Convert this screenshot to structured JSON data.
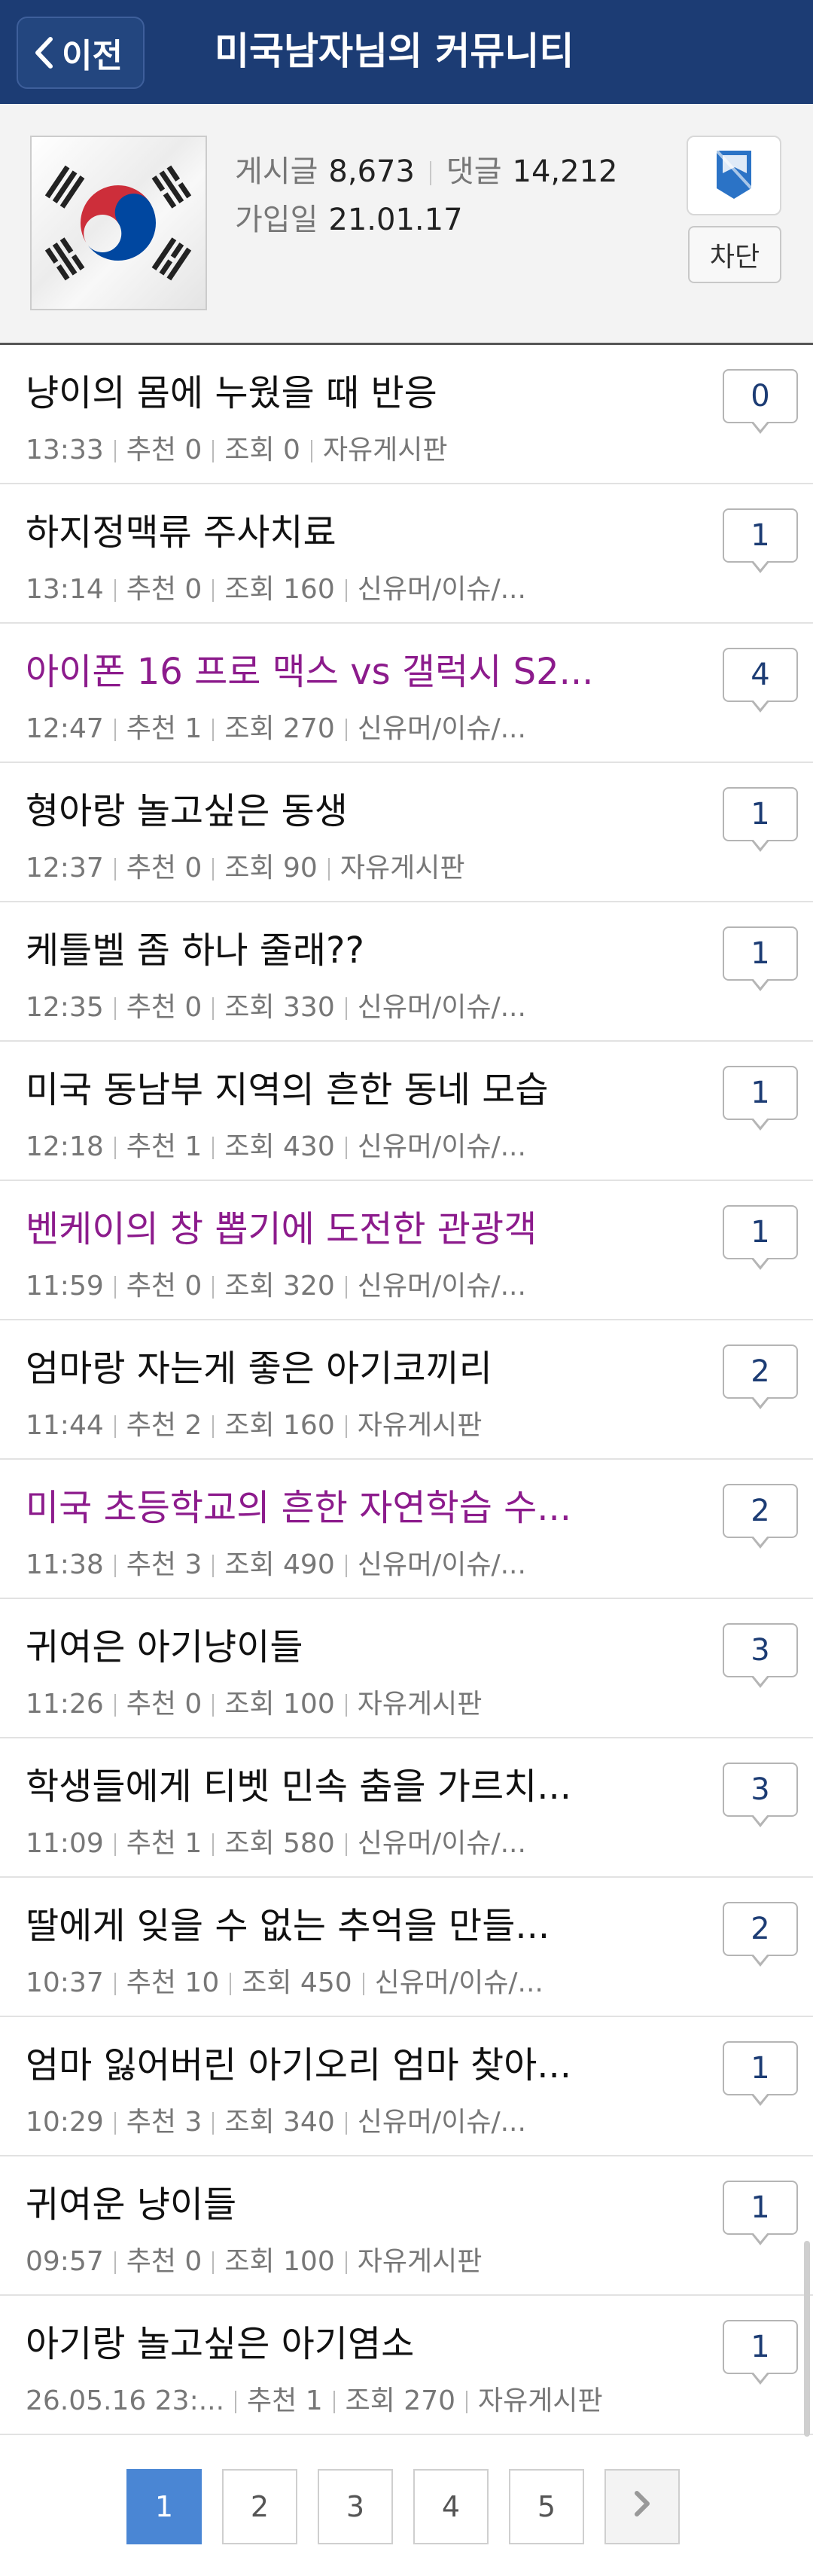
{
  "header": {
    "back_label": "이전",
    "title": "미국남자님의 커뮤니티"
  },
  "profile": {
    "posts_label": "게시글",
    "posts_value": "8,673",
    "comments_label": "댓글",
    "comments_value": "14,212",
    "joined_label": "가입일",
    "joined_value": "21.01.17",
    "block_label": "차단",
    "avatar": "korean-flag",
    "bookmark_icon": "bookmark-icon"
  },
  "posts": [
    {
      "title": "냥이의 몸에 누웠을 때 반응",
      "time": "13:33",
      "recommend": "추천 0",
      "views": "조회 0",
      "board": "자유게시판",
      "comments": "0",
      "visited": false
    },
    {
      "title": "하지정맥류 주사치료",
      "time": "13:14",
      "recommend": "추천 0",
      "views": "조회 160",
      "board": "신유머/이슈/...",
      "comments": "1",
      "visited": false
    },
    {
      "title": "아이폰 16 프로 맥스 vs 갤럭시 S2...",
      "time": "12:47",
      "recommend": "추천 1",
      "views": "조회 270",
      "board": "신유머/이슈/...",
      "comments": "4",
      "visited": true
    },
    {
      "title": "형아랑 놀고싶은 동생",
      "time": "12:37",
      "recommend": "추천 0",
      "views": "조회 90",
      "board": "자유게시판",
      "comments": "1",
      "visited": false
    },
    {
      "title": "케틀벨 좀 하나 줄래??",
      "time": "12:35",
      "recommend": "추천 0",
      "views": "조회 330",
      "board": "신유머/이슈/...",
      "comments": "1",
      "visited": false
    },
    {
      "title": "미국 동남부 지역의 흔한 동네 모습",
      "time": "12:18",
      "recommend": "추천 1",
      "views": "조회 430",
      "board": "신유머/이슈/...",
      "comments": "1",
      "visited": false
    },
    {
      "title": "벤케이의 창 뽑기에 도전한 관광객",
      "time": "11:59",
      "recommend": "추천 0",
      "views": "조회 320",
      "board": "신유머/이슈/...",
      "comments": "1",
      "visited": true
    },
    {
      "title": "엄마랑 자는게 좋은 아기코끼리",
      "time": "11:44",
      "recommend": "추천 2",
      "views": "조회 160",
      "board": "자유게시판",
      "comments": "2",
      "visited": false
    },
    {
      "title": "미국 초등학교의 흔한 자연학습 수...",
      "time": "11:38",
      "recommend": "추천 3",
      "views": "조회 490",
      "board": "신유머/이슈/...",
      "comments": "2",
      "visited": true
    },
    {
      "title": "귀여은 아기냥이들",
      "time": "11:26",
      "recommend": "추천 0",
      "views": "조회 100",
      "board": "자유게시판",
      "comments": "3",
      "visited": false
    },
    {
      "title": "학생들에게 티벳 민속 춤을 가르치...",
      "time": "11:09",
      "recommend": "추천 1",
      "views": "조회 580",
      "board": "신유머/이슈/...",
      "comments": "3",
      "visited": false
    },
    {
      "title": "딸에게 잊을 수 없는 추억을 만들...",
      "time": "10:37",
      "recommend": "추천 10",
      "views": "조회 450",
      "board": "신유머/이슈/...",
      "comments": "2",
      "visited": false
    },
    {
      "title": "엄마 잃어버린 아기오리 엄마 찾아...",
      "time": "10:29",
      "recommend": "추천 3",
      "views": "조회 340",
      "board": "신유머/이슈/...",
      "comments": "1",
      "visited": false
    },
    {
      "title": "귀여운 냥이들",
      "time": "09:57",
      "recommend": "추천 0",
      "views": "조회 100",
      "board": "자유게시판",
      "comments": "1",
      "visited": false
    },
    {
      "title": "아기랑 놀고싶은 아기염소",
      "time": "26.05.16  23:...",
      "recommend": "추천 1",
      "views": "조회 270",
      "board": "자유게시판",
      "comments": "1",
      "visited": false
    }
  ],
  "pagination": {
    "pages": [
      "1",
      "2",
      "3",
      "4",
      "5"
    ],
    "current": "1",
    "next_icon": "chevron-right-icon"
  },
  "colors": {
    "header_bg": "#1c3c74",
    "visited_title": "#8c1b8c",
    "active_page": "#4a86d4"
  }
}
